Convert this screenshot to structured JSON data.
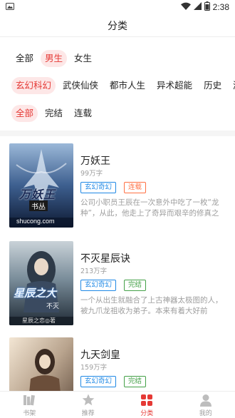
{
  "status_bar": {
    "time": "2:38"
  },
  "header": {
    "title": "分类"
  },
  "filters": {
    "gender": [
      {
        "label": "全部",
        "active": false
      },
      {
        "label": "男生",
        "active": true
      },
      {
        "label": "女生",
        "active": false
      }
    ],
    "genre": [
      {
        "label": "玄幻科幻",
        "active": true
      },
      {
        "label": "武侠仙侠",
        "active": false
      },
      {
        "label": "都市人生",
        "active": false
      },
      {
        "label": "异术超能",
        "active": false
      },
      {
        "label": "历史",
        "active": false
      },
      {
        "label": "游戏",
        "active": false
      }
    ],
    "status": [
      {
        "label": "全部",
        "active": true
      },
      {
        "label": "完结",
        "active": false
      },
      {
        "label": "连载",
        "active": false
      }
    ]
  },
  "books": [
    {
      "title": "万妖王",
      "words": "99万字",
      "genre_tag": "玄幻奇幻",
      "status_tag": "连载",
      "status_color": "#ff7043",
      "description": "公司小职员王辰在一次意外中吃了一枚“龙种”，从此，他走上了奇异而艰辛的修真之路……",
      "cover": {
        "title_text": "万妖王",
        "publisher": "书丛",
        "site": "shucong.com"
      }
    },
    {
      "title": "不灭星辰诀",
      "words": "213万字",
      "genre_tag": "玄幻奇幻",
      "status_tag": "完结",
      "status_color": "#43a047",
      "description": "一个从出生就融合了上古神器太极图的人，被九爪龙祖收为弟子。本来有着大好前程……",
      "cover": {
        "title_text": "星辰之大",
        "subtitle": "不灭",
        "author": "星辰之恋◎著"
      }
    },
    {
      "title": "九天剑皇",
      "words": "159万字",
      "genre_tag": "玄幻奇幻",
      "status_tag": "完结",
      "status_color": "#43a047",
      "description": "",
      "cover": {}
    }
  ],
  "tabbar": [
    {
      "label": "书架",
      "icon": "bookshelf-icon",
      "active": false
    },
    {
      "label": "推荐",
      "icon": "star-icon",
      "active": false
    },
    {
      "label": "分类",
      "icon": "category-grid-icon",
      "active": true
    },
    {
      "label": "我的",
      "icon": "person-icon",
      "active": false
    }
  ],
  "colors": {
    "accent": "#e53935",
    "accent_bg": "#fde7e7",
    "genre_tag": "#1e88e5"
  }
}
